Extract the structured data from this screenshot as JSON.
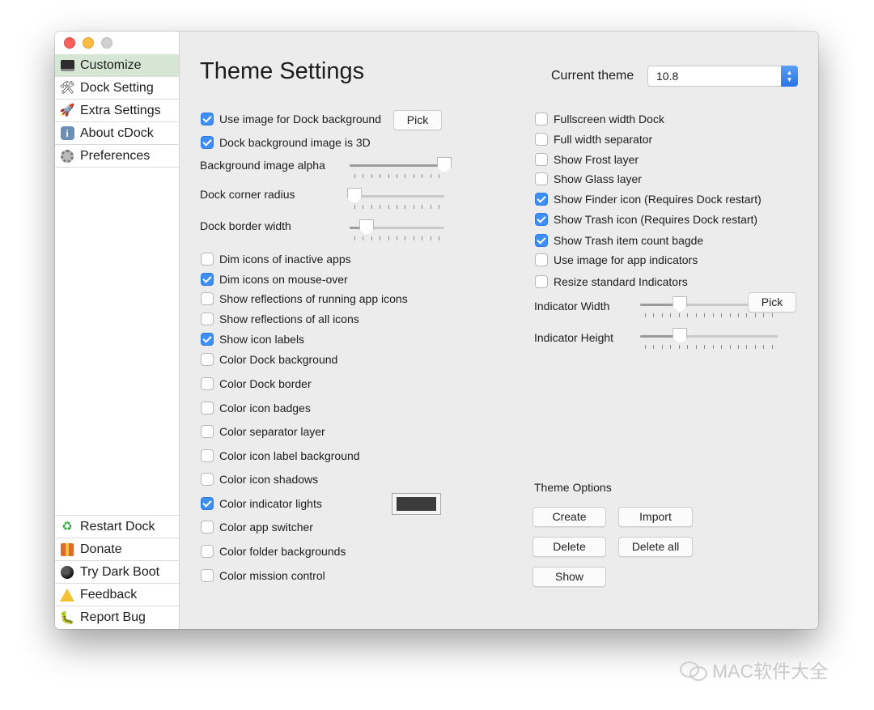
{
  "sidebar": {
    "top_items": [
      {
        "label": "Customize",
        "icon": "laptop-icon",
        "active": true
      },
      {
        "label": "Dock Setting",
        "icon": "tools-icon"
      },
      {
        "label": "Extra Settings",
        "icon": "rocket-icon"
      },
      {
        "label": "About cDock",
        "icon": "info-icon"
      },
      {
        "label": "Preferences",
        "icon": "gear-icon"
      }
    ],
    "bottom_items": [
      {
        "label": "Restart Dock",
        "icon": "recycle-icon"
      },
      {
        "label": "Donate",
        "icon": "gift-icon"
      },
      {
        "label": "Try Dark Boot",
        "icon": "moon-icon"
      },
      {
        "label": "Feedback",
        "icon": "warning-icon"
      },
      {
        "label": "Report Bug",
        "icon": "bug-icon"
      }
    ]
  },
  "header": {
    "title": "Theme Settings",
    "current_theme_label": "Current theme",
    "current_theme_value": "10.8"
  },
  "left_options": [
    {
      "label": "Use image for Dock background",
      "checked": true
    },
    {
      "label": "Dock background image is 3D",
      "checked": true
    },
    {
      "label": "Dim icons of inactive apps",
      "checked": false
    },
    {
      "label": "Dim icons on mouse-over",
      "checked": true
    },
    {
      "label": "Show reflections of running app icons",
      "checked": false
    },
    {
      "label": "Show reflections of all icons",
      "checked": false
    },
    {
      "label": "Show icon labels",
      "checked": true
    },
    {
      "label": "Color Dock background",
      "checked": false
    },
    {
      "label": "Color Dock border",
      "checked": false
    },
    {
      "label": "Color icon badges",
      "checked": false
    },
    {
      "label": "Color separator layer",
      "checked": false
    },
    {
      "label": "Color icon label background",
      "checked": false
    },
    {
      "label": "Color icon shadows",
      "checked": false
    },
    {
      "label": "Color indicator lights",
      "checked": true
    },
    {
      "label": "Color app switcher",
      "checked": false
    },
    {
      "label": "Color folder backgrounds",
      "checked": false
    },
    {
      "label": "Color mission control",
      "checked": false
    }
  ],
  "left_sliders": [
    {
      "label": "Background image alpha",
      "value": 1.0
    },
    {
      "label": "Dock corner radius",
      "value": 0.05
    },
    {
      "label": "Dock border width",
      "value": 0.18
    }
  ],
  "right_options": [
    {
      "label": "Fullscreen width Dock",
      "checked": false
    },
    {
      "label": "Full width separator",
      "checked": false
    },
    {
      "label": "Show Frost layer",
      "checked": false
    },
    {
      "label": "Show Glass layer",
      "checked": false
    },
    {
      "label": "Show Finder icon (Requires Dock restart)",
      "checked": true
    },
    {
      "label": "Show Trash icon (Requires Dock restart)",
      "checked": true
    },
    {
      "label": "Show Trash item count bagde",
      "checked": true
    },
    {
      "label": "Use image for app indicators",
      "checked": false
    },
    {
      "label": "Resize standard Indicators",
      "checked": false
    }
  ],
  "right_sliders": [
    {
      "label": "Indicator Width",
      "value": 0.29
    },
    {
      "label": "Indicator Height",
      "value": 0.29
    }
  ],
  "buttons": {
    "pick": "Pick",
    "pick_indicator": "Pick"
  },
  "indicator_color": "#3c3c3c",
  "theme_options": {
    "title": "Theme Options",
    "create": "Create",
    "import": "Import",
    "delete": "Delete",
    "delete_all": "Delete all",
    "show": "Show"
  },
  "watermark": "MAC软件大全"
}
